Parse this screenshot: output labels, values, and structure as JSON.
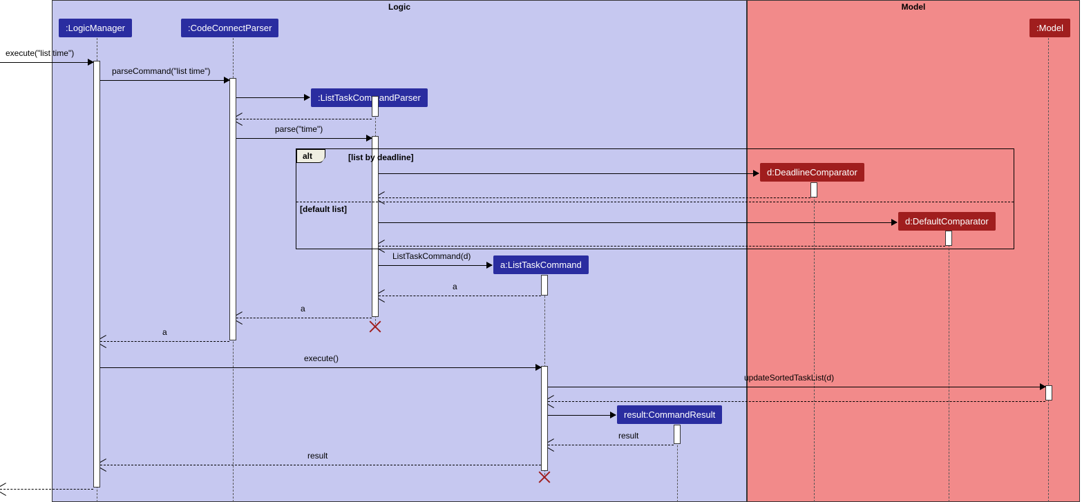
{
  "regions": {
    "logic": "Logic",
    "model": "Model"
  },
  "participants": {
    "logicManager": ":LogicManager",
    "codeConnectParser": ":CodeConnectParser",
    "listTaskCommandParser": ":ListTaskCommandParser",
    "deadlineComparator": "d:DeadlineComparator",
    "defaultComparator": "d:DefaultComparator",
    "listTaskCommand": "a:ListTaskCommand",
    "commandResult": "result:CommandResult",
    "model": ":Model"
  },
  "messages": {
    "executeListTime": "execute(\"list time\")",
    "parseCommandListTime": "parseCommand(\"list time\")",
    "parseTime": "parse(\"time\")",
    "listTaskCommandD": "ListTaskCommand(d)",
    "a1": "a",
    "a2": "a",
    "a3": "a",
    "execute": "execute()",
    "updateSortedTaskList": "updateSortedTaskList(d)",
    "result1": "result",
    "result2": "result"
  },
  "alt": {
    "label": "alt",
    "guard1": "[list by deadline]",
    "guard2": "[default list]"
  }
}
